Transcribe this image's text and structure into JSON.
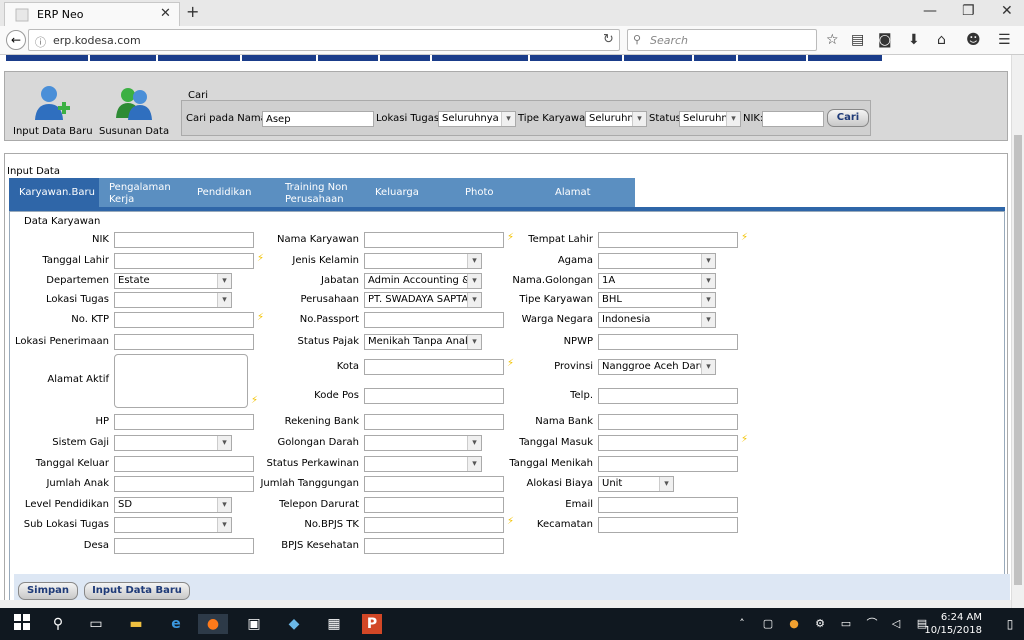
{
  "browser": {
    "tab_title": "ERP Neo",
    "url": "erp.kodesa.com",
    "search_placeholder": "Search"
  },
  "toolbar": {
    "input_data_baru": "Input Data Baru",
    "susunan_data": "Susunan Data"
  },
  "cari": {
    "legend": "Cari",
    "name_label": "Cari pada Nama:",
    "name_value": "Asep",
    "lokasi_label": "Lokasi Tugas:",
    "lokasi_value": "Seluruhnya",
    "tipe_label": "Tipe Karyawan:",
    "tipe_value": "Seluruhnya",
    "status_label": "Status:",
    "status_value": "Seluruhnya",
    "nik_label": "NIK:",
    "nik_value": "",
    "button": "Cari"
  },
  "input": {
    "title": "Input Data",
    "tabs": [
      {
        "label": "Karyawan.Baru"
      },
      {
        "label": "Pengalaman Kerja"
      },
      {
        "label": "Pendidikan"
      },
      {
        "label": "Training Non Perusahaan"
      },
      {
        "label": "Keluarga"
      },
      {
        "label": "Photo"
      },
      {
        "label": "Alamat"
      }
    ],
    "form_title": "Data Karyawan",
    "fields": {
      "nik": {
        "label": "NIK",
        "value": ""
      },
      "tanggal_lahir": {
        "label": "Tanggal Lahir",
        "value": ""
      },
      "departemen": {
        "label": "Departemen",
        "value": "Estate"
      },
      "lokasi_tugas": {
        "label": "Lokasi Tugas",
        "value": ""
      },
      "no_ktp": {
        "label": "No. KTP",
        "value": ""
      },
      "lokasi_penerimaan": {
        "label": "Lokasi Penerimaan",
        "value": ""
      },
      "alamat_aktif": {
        "label": "Alamat Aktif",
        "value": ""
      },
      "hp": {
        "label": "HP",
        "value": ""
      },
      "sistem_gaji": {
        "label": "Sistem Gaji",
        "value": ""
      },
      "tanggal_keluar": {
        "label": "Tanggal Keluar",
        "value": ""
      },
      "jumlah_anak": {
        "label": "Jumlah Anak",
        "value": ""
      },
      "level_pendidikan": {
        "label": "Level Pendidikan",
        "value": "SD"
      },
      "sub_lokasi_tugas": {
        "label": "Sub Lokasi Tugas",
        "value": ""
      },
      "desa": {
        "label": "Desa",
        "value": ""
      },
      "nama_karyawan": {
        "label": "Nama Karyawan",
        "value": ""
      },
      "jenis_kelamin": {
        "label": "Jenis Kelamin",
        "value": ""
      },
      "jabatan": {
        "label": "Jabatan",
        "value": "Admin Accounting & Tax"
      },
      "perusahaan": {
        "label": "Perusahaan",
        "value": "PT. SWADAYA SAPTA"
      },
      "no_passport": {
        "label": "No.Passport",
        "value": ""
      },
      "status_pajak": {
        "label": "Status Pajak",
        "value": "Menikah Tanpa Anak"
      },
      "kota": {
        "label": "Kota",
        "value": ""
      },
      "kode_pos": {
        "label": "Kode Pos",
        "value": ""
      },
      "rekening_bank": {
        "label": "Rekening Bank",
        "value": ""
      },
      "golongan_darah": {
        "label": "Golongan Darah",
        "value": ""
      },
      "status_perkawinan": {
        "label": "Status Perkawinan",
        "value": ""
      },
      "jumlah_tanggungan": {
        "label": "Jumlah Tanggungan",
        "value": ""
      },
      "telepon_darurat": {
        "label": "Telepon Darurat",
        "value": ""
      },
      "no_bpjs_tk": {
        "label": "No.BPJS TK",
        "value": ""
      },
      "bpjs_kesehatan": {
        "label": "BPJS Kesehatan",
        "value": ""
      },
      "tempat_lahir": {
        "label": "Tempat Lahir",
        "value": ""
      },
      "agama": {
        "label": "Agama",
        "value": ""
      },
      "nama_golongan": {
        "label": "Nama.Golongan",
        "value": "1A"
      },
      "tipe_karyawan": {
        "label": "Tipe Karyawan",
        "value": "BHL"
      },
      "warga_negara": {
        "label": "Warga Negara",
        "value": "Indonesia"
      },
      "npwp": {
        "label": "NPWP",
        "value": ""
      },
      "provinsi": {
        "label": "Provinsi",
        "value": "Nanggroe Aceh Darussalam"
      },
      "telp": {
        "label": "Telp.",
        "value": ""
      },
      "nama_bank": {
        "label": "Nama Bank",
        "value": ""
      },
      "tanggal_masuk": {
        "label": "Tanggal Masuk",
        "value": ""
      },
      "tanggal_menikah": {
        "label": "Tanggal Menikah",
        "value": ""
      },
      "alokasi_biaya": {
        "label": "Alokasi Biaya",
        "value": "Unit"
      },
      "email": {
        "label": "Email",
        "value": ""
      },
      "kecamatan": {
        "label": "Kecamatan",
        "value": ""
      }
    },
    "simpan_button": "Simpan",
    "input_data_baru_button": "Input Data Baru"
  },
  "taskbar": {
    "time": "6:24 AM",
    "date": "10/15/2018"
  },
  "colors": {
    "tab_active": "#2f66a8",
    "tab_inactive": "#5b8fc1",
    "menu_strip": "#1a3c8a",
    "required_bolt": "#f2c200"
  }
}
